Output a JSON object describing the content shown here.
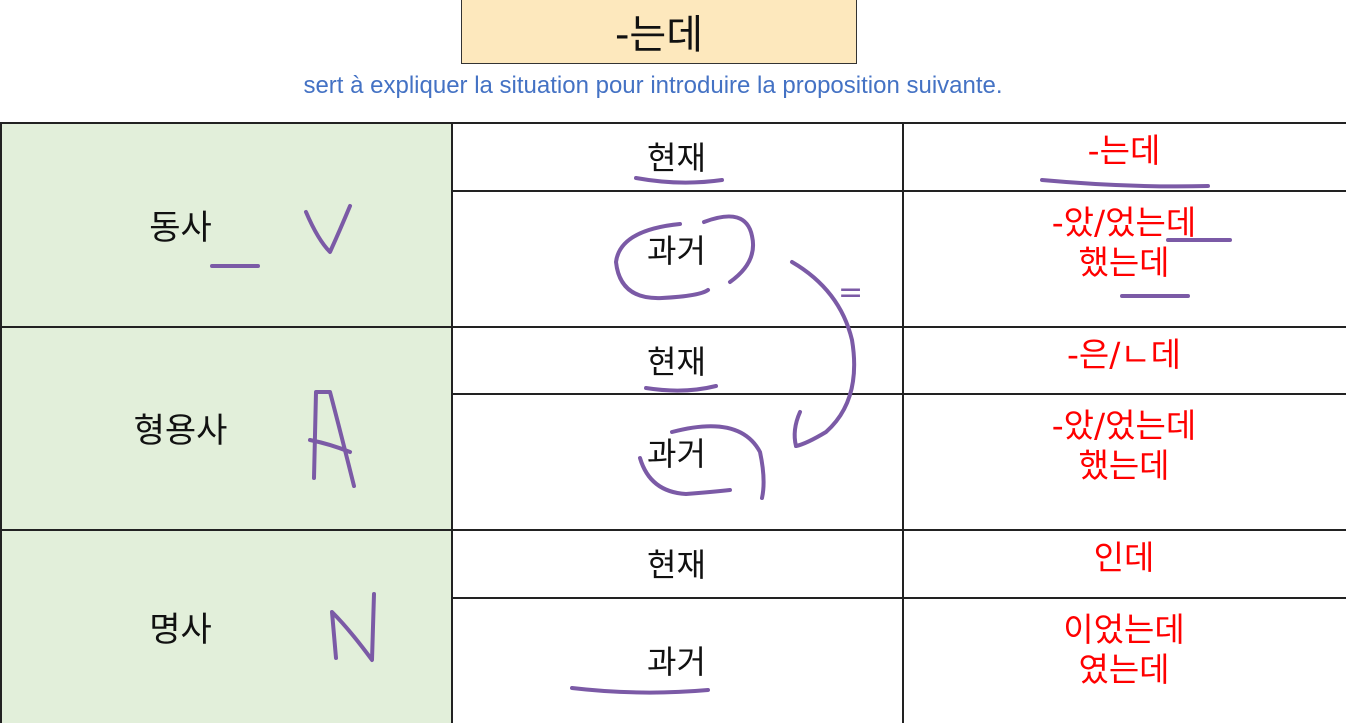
{
  "title": "-는데",
  "subtitle": "sert  à expliquer la situation pour introduire la proposition suivante.",
  "rows": [
    {
      "pos": "동사",
      "letter": "V",
      "tenses": [
        {
          "label": "현재",
          "forms": [
            "-는데"
          ]
        },
        {
          "label": "과거",
          "forms": [
            "-았/었는데",
            "했는데"
          ]
        }
      ]
    },
    {
      "pos": "형용사",
      "letter": "A",
      "tenses": [
        {
          "label": "현재",
          "forms": [
            "-은/ㄴ데"
          ]
        },
        {
          "label": "과거",
          "forms": [
            "-았/었는데",
            "했는데"
          ]
        }
      ]
    },
    {
      "pos": "명사",
      "letter": "N",
      "tenses": [
        {
          "label": "현재",
          "forms": [
            "인데"
          ]
        },
        {
          "label": "과거",
          "forms": [
            "이었는데",
            "였는데"
          ]
        }
      ]
    }
  ],
  "annotation_mark": "=",
  "colors": {
    "title_bg": "#fde8bd",
    "subtitle": "#4472c4",
    "pos_bg": "#e2efda",
    "form_text": "#ff0000",
    "ink": "#7b5aa6"
  }
}
